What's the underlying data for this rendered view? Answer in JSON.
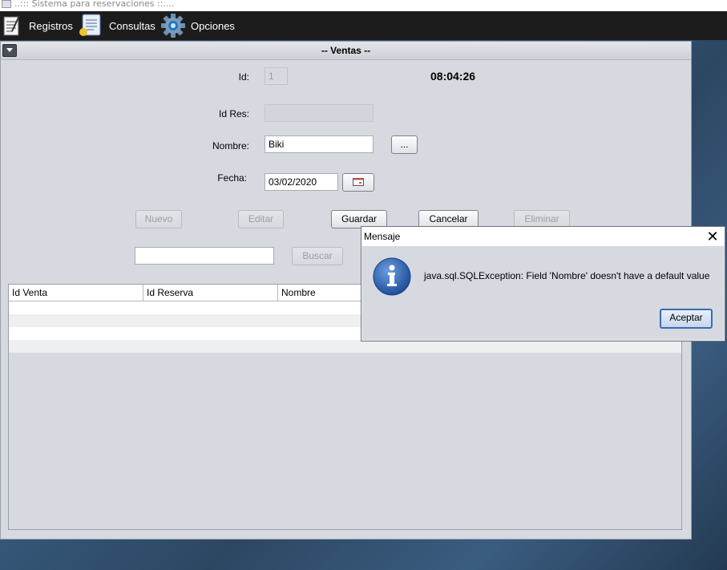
{
  "window": {
    "title": "..::: Sistema para reservaciones ::...."
  },
  "menu": {
    "items": [
      {
        "label": "Registros",
        "icon": "notepad-icon"
      },
      {
        "label": "Consultas",
        "icon": "document-search-icon"
      },
      {
        "label": "Opciones",
        "icon": "gear-icon"
      }
    ]
  },
  "form": {
    "title": "-- Ventas --",
    "id_label": "Id:",
    "id_value": "1",
    "clock": "08:04:26",
    "idres_label": "Id Res:",
    "idres_value": "",
    "nombre_label": "Nombre:",
    "nombre_value": "Biki",
    "browse_label": "...",
    "fecha_label": "Fecha:",
    "fecha_value": "03/02/2020",
    "calendar_icon": "calendar-icon",
    "buttons": {
      "nuevo": "Nuevo",
      "editar": "Editar",
      "guardar": "Guardar",
      "cancelar": "Cancelar",
      "eliminar": "Eliminar"
    },
    "search_value": "",
    "search_button": "Buscar"
  },
  "table": {
    "columns": [
      "Id Venta",
      "Id Reserva",
      "Nombre"
    ]
  },
  "dialog": {
    "title": "Mensaje",
    "message": "java.sql.SQLException: Field 'Nombre' doesn't have a default value",
    "ok": "Aceptar",
    "icon": "info-icon"
  },
  "colors": {
    "menubar": "#1c1c1c",
    "panel": "#d6d9df",
    "accent": "#3b6bb0",
    "info": "#2f5fa8"
  }
}
